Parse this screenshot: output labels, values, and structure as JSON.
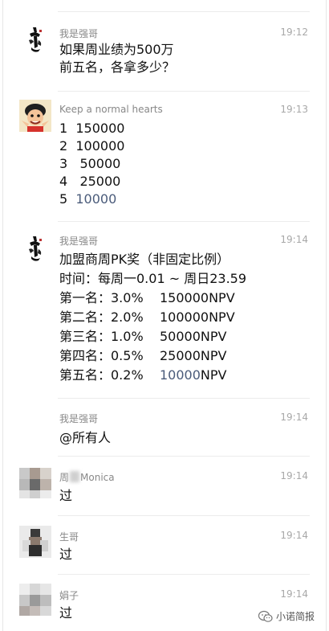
{
  "messages": [
    {
      "sender": "我是强哥",
      "time": "19:12",
      "lines": [
        "如果周业绩为500万",
        "前五名，各拿多少？"
      ]
    },
    {
      "sender": "Keep a normal hearts",
      "time": "19:13",
      "lines": [
        "1  150000",
        "2  100000",
        "3   50000",
        "4   25000"
      ],
      "last_prefix": "5  ",
      "last_value": "10000"
    },
    {
      "sender": "我是强哥",
      "time": "19:14",
      "lines": [
        "加盟商周PK奖（非固定比例）",
        "时间：每周一0.01 ~ 周日23.59",
        "第一名：3.0%    150000NPV",
        "第二名：2.0%    100000NPV",
        "第三名：1.0%    50000NPV",
        "第四名：0.5%    25000NPV"
      ],
      "last_prefix": "第五名：0.2%    ",
      "last_value": "10000",
      "last_suffix": "NPV"
    },
    {
      "sender": "我是强哥",
      "time": "19:14",
      "lines": [
        "@所有人"
      ]
    },
    {
      "sender_first": "周",
      "sender_rest": "Monica",
      "time": "19:14",
      "lines": [
        "过"
      ]
    },
    {
      "sender": "生哥",
      "time": "19:14",
      "lines": [
        "过"
      ]
    },
    {
      "sender": "娟子",
      "time": "19:14",
      "lines": [
        "过"
      ]
    }
  ],
  "watermark": {
    "text": "小诺简报",
    "icon": "wechat-official-account-icon"
  },
  "colors": {
    "sender": "#888888",
    "time": "#a8a8a8",
    "text": "#111111",
    "highlight_number": "#4a5b7a",
    "divider": "#ececec"
  }
}
